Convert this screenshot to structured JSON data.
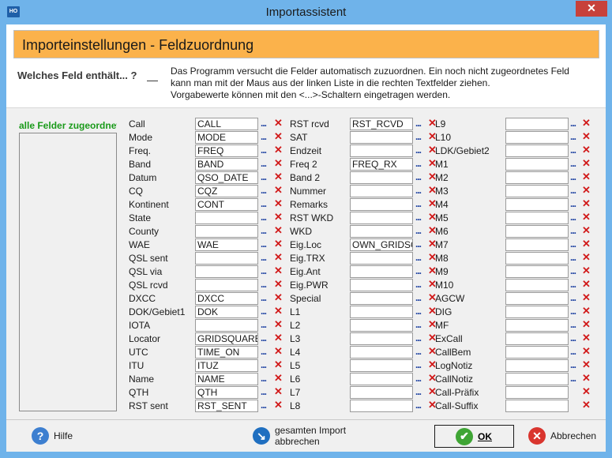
{
  "window": {
    "title": "Importassistent",
    "app_icon": "HO"
  },
  "header": {
    "title": "Importeinstellungen - Feldzuordnung",
    "question": "Welches Feld enthält... ?",
    "info_lines": [
      "Das Programm versucht die Felder automatisch zuzuordnen. Ein noch nicht zugeordnetes Feld",
      "kann man mit der Maus aus der linken Liste in die rechten Textfelder ziehen.",
      "Vorgabewerte können mit den <...>-Schaltern eingetragen werden."
    ]
  },
  "left": {
    "label": "alle Felder zugeordnet"
  },
  "columns": [
    [
      {
        "label": "Call",
        "value": "CALL"
      },
      {
        "label": "Mode",
        "value": "MODE"
      },
      {
        "label": "Freq.",
        "value": "FREQ"
      },
      {
        "label": "Band",
        "value": "BAND"
      },
      {
        "label": "Datum",
        "value": "QSO_DATE"
      },
      {
        "label": "CQ",
        "value": "CQZ"
      },
      {
        "label": "Kontinent",
        "value": "CONT"
      },
      {
        "label": "State",
        "value": ""
      },
      {
        "label": "County",
        "value": ""
      },
      {
        "label": "WAE",
        "value": "WAE"
      },
      {
        "label": "QSL sent",
        "value": ""
      },
      {
        "label": "QSL via",
        "value": ""
      },
      {
        "label": "QSL rcvd",
        "value": ""
      },
      {
        "label": "DXCC",
        "value": "DXCC"
      },
      {
        "label": "DOK/Gebiet1",
        "value": "DOK"
      },
      {
        "label": "IOTA",
        "value": ""
      },
      {
        "label": "Locator",
        "value": "GRIDSQUARE"
      },
      {
        "label": "UTC",
        "value": "TIME_ON"
      },
      {
        "label": "ITU",
        "value": "ITUZ"
      },
      {
        "label": "Name",
        "value": "NAME"
      },
      {
        "label": "QTH",
        "value": "QTH"
      },
      {
        "label": "RST sent",
        "value": "RST_SENT"
      }
    ],
    [
      {
        "label": "RST rcvd",
        "value": "RST_RCVD"
      },
      {
        "label": "SAT",
        "value": ""
      },
      {
        "label": "Endzeit",
        "value": ""
      },
      {
        "label": "Freq 2",
        "value": "FREQ_RX"
      },
      {
        "label": "Band 2",
        "value": ""
      },
      {
        "label": "Nummer",
        "value": ""
      },
      {
        "label": "Remarks",
        "value": ""
      },
      {
        "label": "RST WKD",
        "value": ""
      },
      {
        "label": "WKD",
        "value": ""
      },
      {
        "label": "Eig.Loc",
        "value": "OWN_GRIDSQUARE"
      },
      {
        "label": "Eig.TRX",
        "value": ""
      },
      {
        "label": "Eig.Ant",
        "value": ""
      },
      {
        "label": "Eig.PWR",
        "value": ""
      },
      {
        "label": "Special",
        "value": ""
      },
      {
        "label": "L1",
        "value": ""
      },
      {
        "label": "L2",
        "value": ""
      },
      {
        "label": "L3",
        "value": ""
      },
      {
        "label": "L4",
        "value": ""
      },
      {
        "label": "L5",
        "value": ""
      },
      {
        "label": "L6",
        "value": ""
      },
      {
        "label": "L7",
        "value": ""
      },
      {
        "label": "L8",
        "value": ""
      }
    ],
    [
      {
        "label": "L9",
        "value": ""
      },
      {
        "label": "L10",
        "value": ""
      },
      {
        "label": "LDK/Gebiet2",
        "value": ""
      },
      {
        "label": "M1",
        "value": ""
      },
      {
        "label": "M2",
        "value": ""
      },
      {
        "label": "M3",
        "value": ""
      },
      {
        "label": "M4",
        "value": ""
      },
      {
        "label": "M5",
        "value": ""
      },
      {
        "label": "M6",
        "value": ""
      },
      {
        "label": "M7",
        "value": ""
      },
      {
        "label": "M8",
        "value": ""
      },
      {
        "label": "M9",
        "value": ""
      },
      {
        "label": "M10",
        "value": ""
      },
      {
        "label": "AGCW",
        "value": ""
      },
      {
        "label": "DIG",
        "value": ""
      },
      {
        "label": "MF",
        "value": ""
      },
      {
        "label": "ExCall",
        "value": ""
      },
      {
        "label": "CallBem",
        "value": ""
      },
      {
        "label": "LogNotiz",
        "value": ""
      },
      {
        "label": "CallNotiz",
        "value": ""
      },
      {
        "label": "Call-Präfix",
        "value": "",
        "no_dots": true
      },
      {
        "label": "Call-Suffix",
        "value": "",
        "no_dots": true
      }
    ]
  ],
  "symbols": {
    "dots": "...",
    "clear": "✕"
  },
  "footer": {
    "help": "Hilfe",
    "abort_all_line1": "gesamten Import",
    "abort_all_line2": "abbrechen",
    "ok": "OK",
    "cancel": "Abbrechen"
  },
  "colors": {
    "accent_orange": "#fbb24b",
    "title_bar": "#6fb3ea",
    "clear_red": "#d11a1a",
    "ok_green": "#3fa535",
    "cancel_red": "#d9352e",
    "help_blue": "#3d7fd0"
  }
}
